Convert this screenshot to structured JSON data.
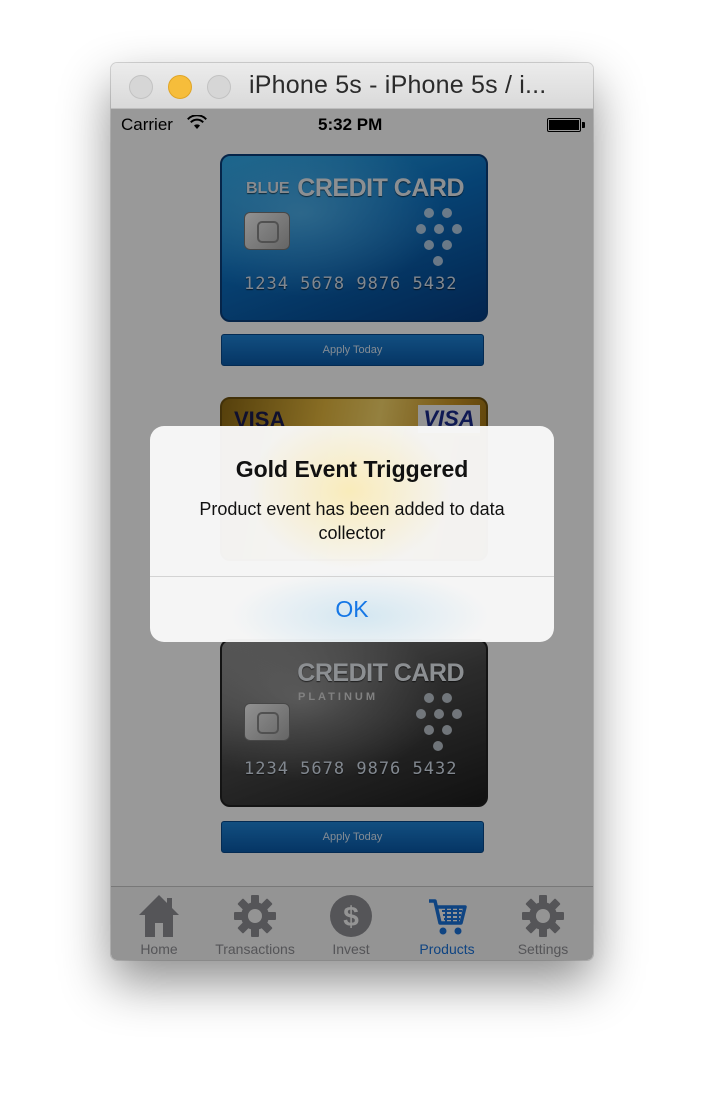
{
  "window": {
    "title": "iPhone 5s - iPhone 5s / i..."
  },
  "status_bar": {
    "carrier": "Carrier",
    "time": "5:32 PM"
  },
  "cards": [
    {
      "prefix": "BLUE",
      "title": "CREDIT CARD",
      "number": "1234 5678 9876 5432",
      "button": "Apply Today"
    },
    {
      "brand_left": "VISA",
      "logo": "VISA"
    },
    {
      "title": "CREDIT CARD",
      "subtitle": "PLATINUM",
      "number": "1234 5678 9876 5432",
      "button": "Apply Today"
    }
  ],
  "tabs": [
    {
      "label": "Home",
      "icon": "home-icon"
    },
    {
      "label": "Transactions",
      "icon": "gear-icon"
    },
    {
      "label": "Invest",
      "icon": "dollar-icon"
    },
    {
      "label": "Products",
      "icon": "cart-icon",
      "active": true
    },
    {
      "label": "Settings",
      "icon": "gear-icon"
    }
  ],
  "alert": {
    "title": "Gold Event Triggered",
    "message": "Product event has been added to data collector",
    "ok": "OK"
  },
  "colors": {
    "accent": "#1577e6",
    "active_tab": "#1a72d9",
    "inactive_tab": "#8e8e93"
  }
}
